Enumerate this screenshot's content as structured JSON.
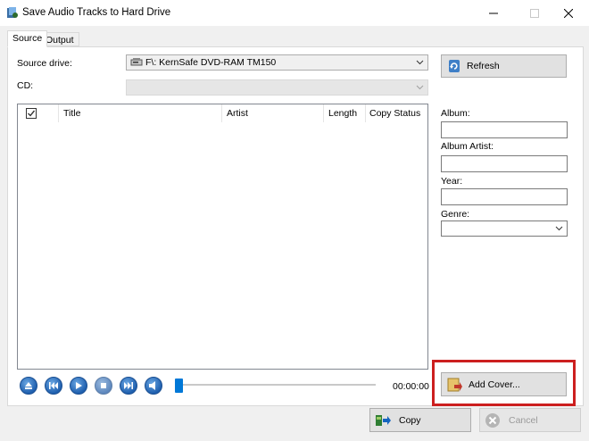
{
  "window": {
    "title": "Save Audio Tracks to Hard Drive"
  },
  "tabs": [
    {
      "label": "Source",
      "active": true
    },
    {
      "label": "Output",
      "active": false
    }
  ],
  "source": {
    "drive_label": "Source drive:",
    "drive_value": "F\\: KernSafe DVD-RAM TM150",
    "cd_label": "CD:",
    "cd_value": "",
    "refresh_label": "Refresh"
  },
  "track_list": {
    "columns": [
      "Title",
      "Artist",
      "Length",
      "Copy Status"
    ],
    "header_checked": true,
    "rows": []
  },
  "metadata": {
    "album_label": "Album:",
    "album_value": "",
    "album_artist_label": "Album Artist:",
    "album_artist_value": "",
    "year_label": "Year:",
    "year_value": "",
    "genre_label": "Genre:",
    "genre_value": ""
  },
  "player": {
    "time": "00:00:00",
    "position_fraction": 0.0
  },
  "actions": {
    "add_cover_label": "Add Cover...",
    "copy_label": "Copy",
    "cancel_label": "Cancel"
  },
  "colors": {
    "accent": "#0078d7",
    "highlight": "#cc1f1f"
  }
}
